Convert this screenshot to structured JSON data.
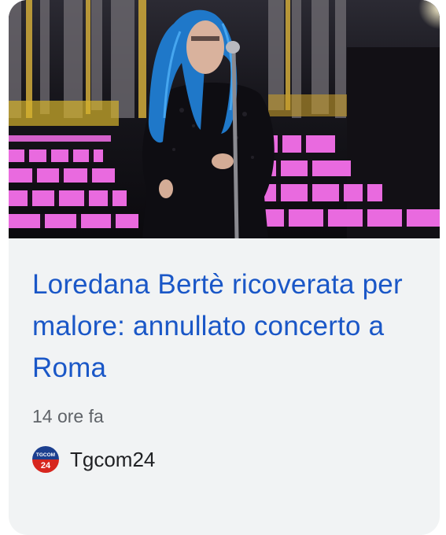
{
  "article": {
    "headline": "Loredana Bertè ricoverata per malore: annullato concerto a Roma",
    "time": "14 ore fa",
    "source": "Tgcom24",
    "source_logo_text": {
      "top": "TGCOM",
      "bottom": "24"
    }
  },
  "image": {
    "description_icon": "performer-on-stage-photo"
  },
  "colors": {
    "card_bg": "#f1f3f4",
    "headline": "#1a57c7",
    "meta": "#5f6368",
    "logo_red": "#d7261e",
    "logo_blue": "#1c3f8f"
  }
}
